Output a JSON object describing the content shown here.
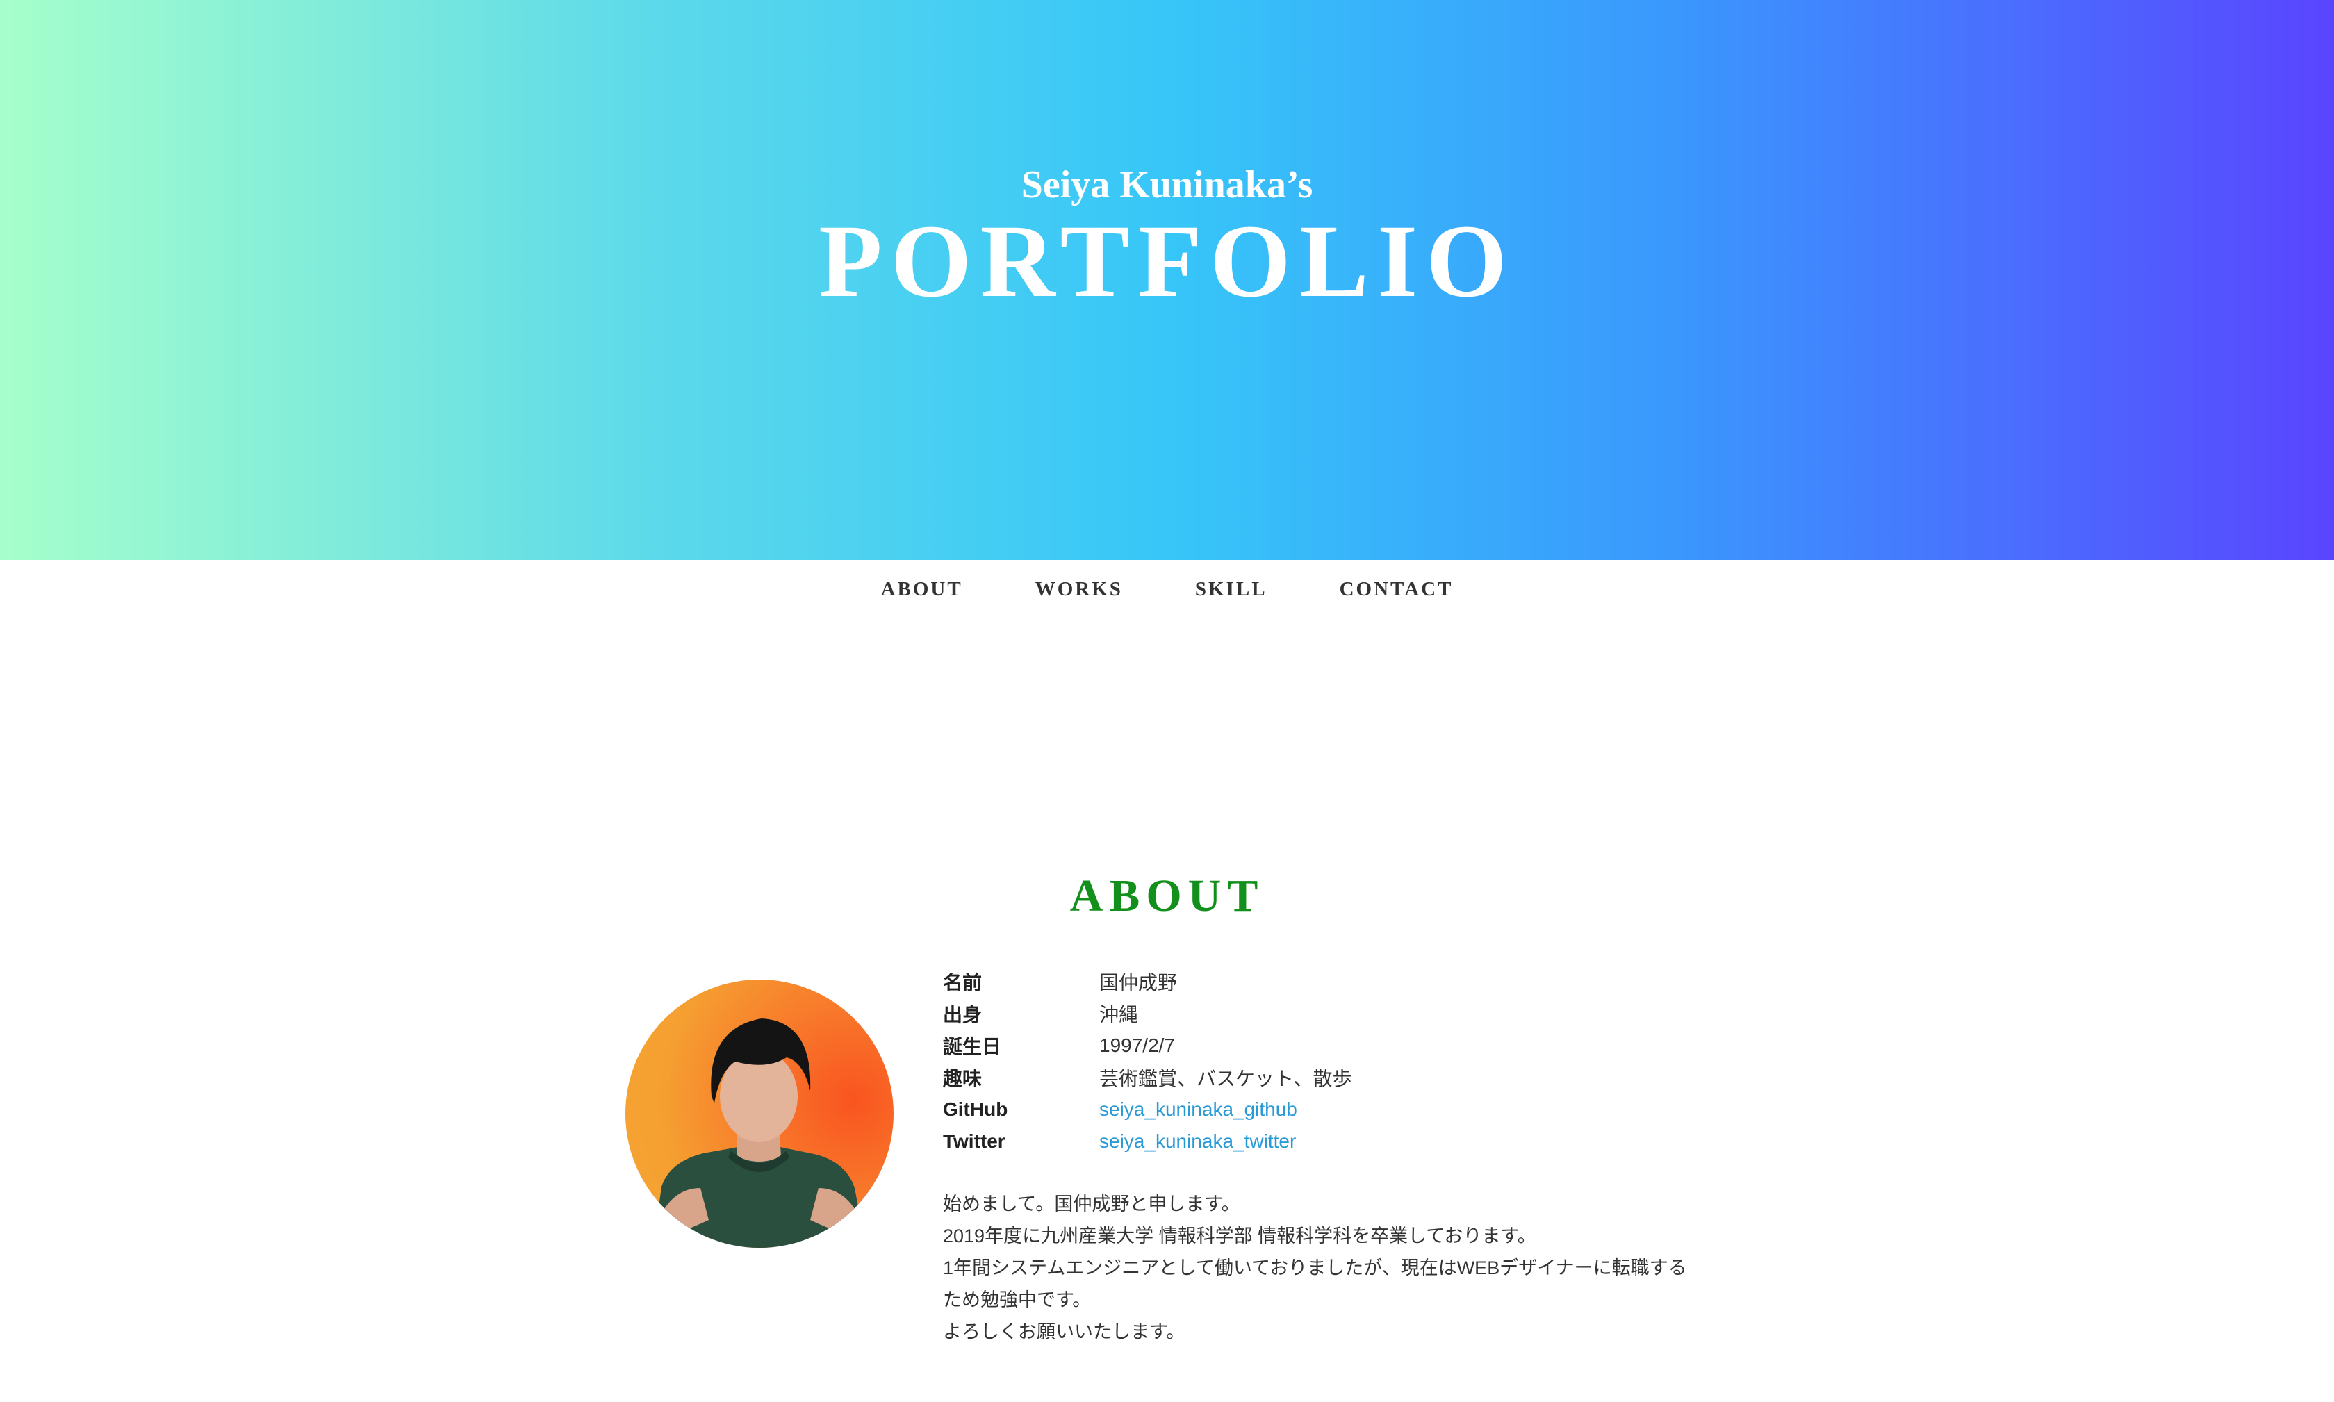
{
  "hero": {
    "subtitle": "Seiya Kuninaka’s",
    "title": "PORTFOLIO"
  },
  "nav": {
    "items": [
      {
        "label": "ABOUT"
      },
      {
        "label": "WORKS"
      },
      {
        "label": "SKILL"
      },
      {
        "label": "CONTACT"
      }
    ]
  },
  "about": {
    "heading": "ABOUT",
    "profile": [
      {
        "label": "名前",
        "value": "国仲成野"
      },
      {
        "label": "出身",
        "value": "沖縄"
      },
      {
        "label": "誕生日",
        "value": "1997/2/7"
      },
      {
        "label": "趣味",
        "value": "芸術鑑賞、バスケット、散歩"
      },
      {
        "label": "GitHub",
        "value": "seiya_kuninaka_github"
      },
      {
        "label": "Twitter",
        "value": "seiya_kuninaka_twitter"
      }
    ],
    "intro": [
      "始めまして。国仲成野と申します。",
      "2019年度に九州産業大学 情報科学部 情報科学科を卒業しております。",
      "1年間システムエンジニアとして働いておりましたが、現在はWEBデザイナーに転職する",
      "ため勉強中です。",
      "よろしくお願いいたします。"
    ]
  },
  "colors": {
    "heading_green": "#138f1c",
    "link_blue": "#2a9ad6",
    "gradient_start": "#a6ffcb",
    "gradient_mid": "#37c6f8",
    "gradient_end": "#5a45ff"
  }
}
